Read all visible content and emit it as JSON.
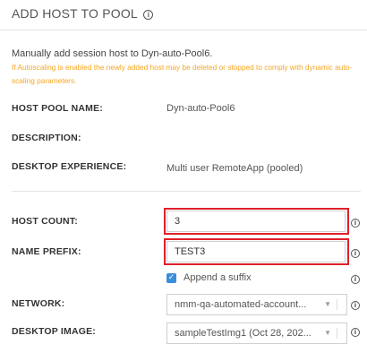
{
  "header": {
    "title": "ADD HOST TO POOL"
  },
  "intro": "Manually add session host to Dyn-auto-Pool6.",
  "warning": "If Autoscaling is enabled the newly added host may be deleted or stopped to comply with dynamic auto-scaling parameters.",
  "fields": {
    "host_pool_name": {
      "label": "HOST POOL NAME:",
      "value": "Dyn-auto-Pool6"
    },
    "description": {
      "label": "DESCRIPTION:",
      "value": ""
    },
    "desktop_experience": {
      "label": "DESKTOP EXPERIENCE:",
      "value": "Multi user RemoteApp (pooled)"
    },
    "host_count": {
      "label": "HOST COUNT:",
      "value": "3"
    },
    "name_prefix": {
      "label": "NAME PREFIX:",
      "value": "TEST3"
    },
    "append_suffix": {
      "label": "Append a suffix",
      "checked": true
    },
    "network": {
      "label": "NETWORK:",
      "value": "nmm-qa-automated-account..."
    },
    "desktop_image": {
      "label": "DESKTOP IMAGE:",
      "value": "sampleTestImg1 (Oct 28, 202..."
    }
  },
  "colors": {
    "warning": "#f5a623",
    "highlight": "#e0202a",
    "checkbox": "#3b8fd9"
  },
  "icons": {
    "info": "info-circle-icon",
    "caret": "chevron-down-icon",
    "check": "checkmark-icon"
  }
}
